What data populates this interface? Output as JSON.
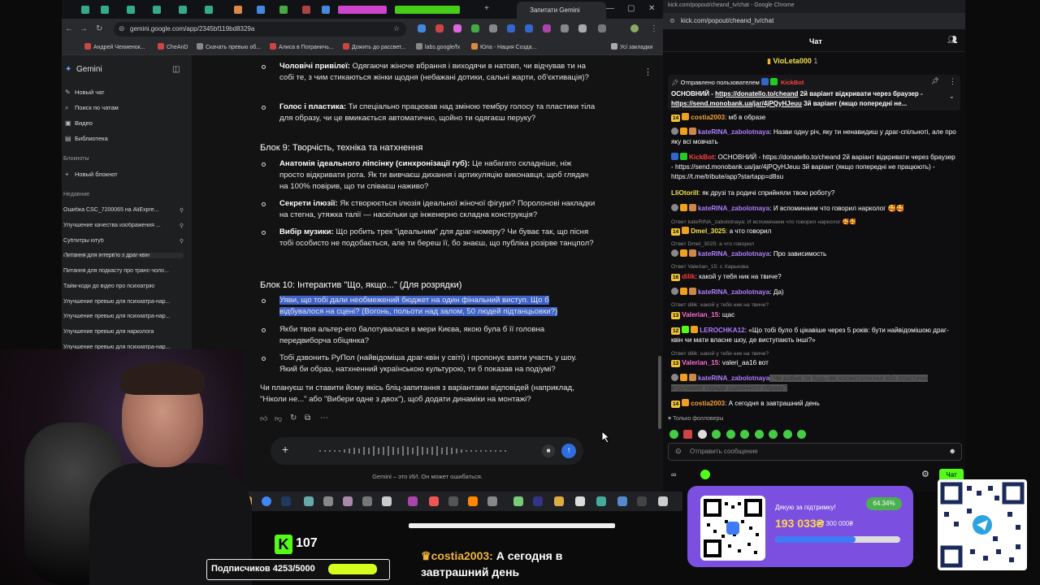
{
  "browser": {
    "active_tab": "Запитати Gemini",
    "url": "gemini.google.com/app/2345bf119bd8329a",
    "bookmarks": [
      "Андрей Чехменок...",
      "CheAnD",
      "Скачать превью об...",
      "Алиса в Пограничь...",
      "Дожить до рассвет...",
      "labs.google/fx",
      "Юла - Нация Созда...",
      "Усі закладки"
    ]
  },
  "gemini": {
    "brand": "Gemini",
    "new_chat": "Новый чат",
    "search_chats": "Поиск по чатам",
    "video": "Видео",
    "library": "Библиотека",
    "notebooks_header": "Блокноты",
    "new_notebook": "Новый блокнот",
    "recent_header": "Недавние",
    "history": [
      "Ошибка CSC_7200065 на AliExpre...",
      "Улучшение качества изображения ...",
      "Субтитры ютуб",
      "Питання для інтерв'ю з драг-квін",
      "Питання для подкасту про транс-чоло...",
      "Тайм-коди до відео про психіатрію",
      "Улучшение превью для психиатра-нар...",
      "Улучшение превью для психиатра-нар...",
      "Улучшение превью для нарколога",
      "Улучшение превью для психиатра-нар..."
    ],
    "content": {
      "b1_title": "Чоловічі привілеї:",
      "b1_text": " Одягаючи жіноче вбрання і виходячи в натовп, чи відчував ти на собі те, з чим стикаються жінки щодня (небажані дотики, сальні жарти, об'єктивація)?",
      "b2_title": "Голос і пластика:",
      "b2_text": " Ти спеціально працював над зміною тембру голосу та пластики тіла для образу, чи це вмикається автоматично, щойно ти одягаєш перуку?",
      "block9": "Блок 9: Творчість, техніка та натхнення",
      "b3_title": "Анатомія ідеального ліпсінку (синхронізації губ):",
      "b3_text": " Це набагато складніше, ніж просто відкривати рота. Як ти вивчаєш дихання і артикуляцію виконавця, щоб глядач на 100% повірив, що ти співаєш наживо?",
      "b4_title": "Секрети ілюзії:",
      "b4_text": " Як створюється ілюзія ідеальної жіночої фігури? Поролонові накладки на стегна, утяжка талії — наскільки це інженерно складна конструкція?",
      "b5_title": "Вибір музики:",
      "b5_text": " Що робить трек \"ідеальним\" для драг-номеру? Чи буває так, що пісня тобі особисто не подобається, але ти береш її, бо знаєш, що публіка розірве танцпол?",
      "block10": "Блок 10: Інтерактив \"Що, якщо...\" (Для розрядки)",
      "b6_line1": "Уяви, що тобі дали необмежений бюджет на один фінальний виступ. Що б",
      "b6_line2": "відбувалося на сцені? (Вогонь, польоти над залом, 50 людей підтанцьовки?)",
      "b7_text": "Якби твоя альтер-его балотувалася в мери Києва, якою була б її головна передвиборча обіцянка?",
      "b8_text": "Тобі дзвонить РуПол (найвідоміша драг-квін у світі) і пропонує взяти участь у шоу. Який би образ, натхненний українською культурою, ти б показав на подіумі?",
      "closing": "Чи плануєш ти ставити йому якісь бліц-запитання з варіантами відповідей (наприклад, \"Ніколи не...\" або \"Вибери одне з двох\"), щоб додати динаміки на монтажі?"
    },
    "disclaimer": "Gemini – это ИИ. Он может ошибаться."
  },
  "chat": {
    "popout": "kick.com/popout/cheand_tv/chat - Google Chrome",
    "url": "kick.com/popout/cheand_tv/chat",
    "header": "Чат",
    "top_gifter": "VioLeta000",
    "top_gifter_count": "1",
    "pinned_by": "Отправлено пользователем",
    "pinned_user": "KickBot",
    "pinned_main": "ОСНОВНИЙ - ",
    "pinned_link1": "https://donatello.to/cheand",
    "pinned_mid": " 2й варіант відкривати через браузер - ",
    "pinned_link2": "https://send.monobank.ua/jar/4jPQyHJeuu",
    "pinned_end": " 3й варіант (якщо попередні не...",
    "messages": [
      {
        "n": "14",
        "user": "costia2003",
        "text": ": мб в образе"
      },
      {
        "n": "",
        "user": "kateRINA_zabolotnaya",
        "text": ": Назви одну річ, яку ти ненавидиш у драг-спільноті, але про яку всі мовчать"
      },
      {
        "n": "",
        "user": "KickBot",
        "text": ": ОСНОВНИЙ - https://donatello.to/cheand 2й варіант відкривати через браузер - https://send.monobank.ua/jar/4jPQyHJeuu 3й варіант (якщо попередні не працюють) - https://t.me/tribute/app?startapp=d8su"
      },
      {
        "n": "",
        "user": "LliOtorill",
        "text": ": як друзі та родичі сприйняли твою роботу?"
      },
      {
        "n": "",
        "user": "kateRINA_zabolotnaya",
        "text": ": И вспоминаем что говорил нарколог 🥰🥰"
      },
      {
        "n": "14",
        "user": "Dmel_3025",
        "text": ": а что говорил"
      },
      {
        "n": "",
        "user": "kateRINA_zabolotnaya",
        "text": ": Про зависимость"
      },
      {
        "n": "16",
        "user": "dilik",
        "text": ": какой у тебя ник на твиче?"
      },
      {
        "n": "",
        "user": "kateRINA_zabolotnaya",
        "text": ": Да)"
      },
      {
        "n": "13",
        "user": "Valerian_15",
        "text": ": щас"
      },
      {
        "n": "12",
        "user": "LEROCHKA12",
        "text": ": «Що тобі було б цікавіше через 5 років: бути найвідомішою драг-квін чи мати власне шоу, де виступають інші?»"
      },
      {
        "n": "13",
        "user": "Valerian_15",
        "text": ": valeri_aa16 вот"
      },
      {
        "n": "",
        "user": "kateRINA_zabolotnaya",
        "text": ": Чи робив ти будь-які косметологічні або пластичні втручання заради сценічного образу?"
      },
      {
        "n": "14",
        "user": "costia2003",
        "text": ": А сегодня в завтрашний день"
      }
    ],
    "replies": [
      "Ответ kateRINA_zabolotnaya: И вспоминаем что говорил нарколог 🥰🥰",
      "Ответ Dmel_3025: а что говорил",
      "Ответ Valerian_15: с Харькова",
      "Ответ dilik: какой у тебя ник на твиче?",
      "Ответ dilik: какой у тебя ник на твиче?"
    ],
    "followers_only": "Только фолловеры",
    "input_placeholder": "Отправить сообщение",
    "send_button": "Чат"
  },
  "stream": {
    "kick_followers": "107",
    "subs_label": "Подписчиков 4253/5000",
    "subs_progress": 0.85,
    "overlay_user": "costia2003:",
    "overlay_text": " А сегодня в завтрашний день",
    "donation_thanks": "Дякую за підтримку!",
    "donation_amount": "193 033₴",
    "donation_goal": "/ 300 000₴",
    "donation_pct": "64.34%",
    "donation_progress": 0.6434
  },
  "colors": {
    "kick_green": "#53fc18",
    "highlight": "#3e62c7",
    "username_purple": "#b07cff",
    "username_orange": "#f3a13a",
    "donation_bg": "#7b4fe0"
  }
}
